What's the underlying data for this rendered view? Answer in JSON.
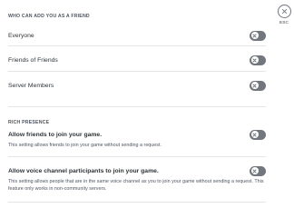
{
  "friend_requests": {
    "section_title": "WHO CAN ADD YOU AS A FRIEND",
    "options": [
      {
        "label": "Everyone",
        "enabled": false
      },
      {
        "label": "Friends of Friends",
        "enabled": false
      },
      {
        "label": "Server Members",
        "enabled": false
      }
    ]
  },
  "rich_presence": {
    "section_title": "RICH PRESENCE",
    "join_friends": {
      "label": "Allow friends to join your game.",
      "description": "This setting allows friends to join your game without sending a request.",
      "enabled": false
    },
    "join_voice": {
      "label": "Allow voice channel participants to join your game.",
      "description": "This setting allows people that are in the same voice channel as you to join your game without sending a request. This feature only works in non-community servers.",
      "enabled": false
    }
  },
  "close": {
    "esc_label": "ESC",
    "icon": "close-icon"
  },
  "colors": {
    "toggle_off": "#72767d",
    "divider": "#e3e5e8",
    "text": "#2e3338",
    "muted": "#4f5660"
  }
}
